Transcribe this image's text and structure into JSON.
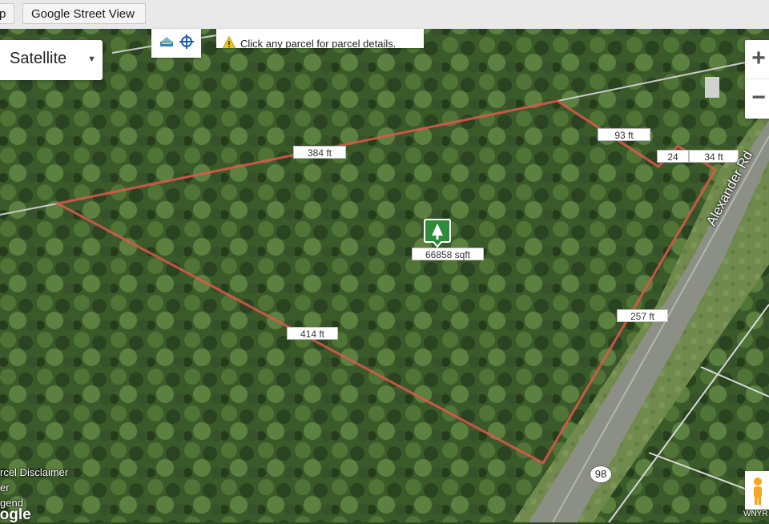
{
  "tabs": {
    "map": "p",
    "street_view": "Google Street View"
  },
  "map_type": {
    "selected": "Satellite"
  },
  "notice": {
    "message": "Click any parcel for parcel details."
  },
  "zoom": {
    "in": "+",
    "out": "−"
  },
  "parcel": {
    "area": "66858 sqft",
    "sides": [
      "384 ft",
      "93 ft",
      "24",
      "34 ft",
      "257 ft",
      "414 ft"
    ],
    "outline_color": "#e2574c"
  },
  "road": {
    "name": "Alexander Rd",
    "route": "98"
  },
  "footer": {
    "links": [
      "rcel Disclaimer",
      "er",
      "gend"
    ],
    "google": "oogle",
    "attribution": "WNYR"
  },
  "icons": {
    "tools": [
      "layers-icon",
      "locate-icon"
    ],
    "warning": "warning-icon",
    "marker": "tree-marker-icon",
    "pegman": "pegman-icon"
  }
}
